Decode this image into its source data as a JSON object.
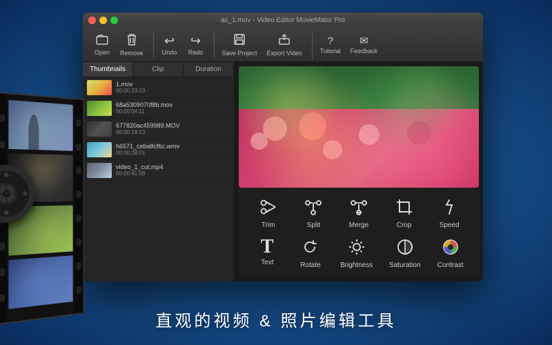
{
  "window": {
    "title": "ac_1.mov - Video Editor MovieMator Pro",
    "controls": {
      "close": "close",
      "minimize": "minimize",
      "maximize": "maximize"
    }
  },
  "toolbar": {
    "buttons": [
      {
        "id": "open",
        "label": "Open",
        "icon": "folder-icon"
      },
      {
        "id": "remove",
        "label": "Remove",
        "icon": "trash-icon"
      },
      {
        "id": "undo",
        "label": "Undo",
        "icon": "undo-icon"
      },
      {
        "id": "redo",
        "label": "Redo",
        "icon": "redo-icon"
      },
      {
        "id": "save",
        "label": "Save Project",
        "icon": "save-icon"
      },
      {
        "id": "export",
        "label": "Export Video",
        "icon": "export-icon"
      },
      {
        "id": "tutorial",
        "label": "Tutorial",
        "icon": "tutorial-icon"
      },
      {
        "id": "feedback",
        "label": "Feedback",
        "icon": "feedback-icon"
      }
    ]
  },
  "panel": {
    "tabs": [
      {
        "id": "thumbnails",
        "label": "Thumbnails",
        "active": true
      },
      {
        "id": "clip",
        "label": "Clip"
      },
      {
        "id": "duration",
        "label": "Duration"
      }
    ]
  },
  "clips": [
    {
      "name": "1.mov",
      "duration": "00:00:23:23",
      "thumb": "flowers"
    },
    {
      "name": "68a5309070f8b.mov",
      "duration": "00:00:04:11",
      "thumb": "nature"
    },
    {
      "name": "677820ac459989.MOV",
      "duration": "00:00:18:13",
      "thumb": "dark"
    },
    {
      "name": "h6571_ceba8cf6c.wmv",
      "duration": "00:00:28:01",
      "thumb": "beach"
    },
    {
      "name": "video_1_cut.mp4",
      "duration": "00:00:41:08",
      "thumb": "city"
    }
  ],
  "tools": {
    "row1": [
      {
        "id": "trim",
        "label": "Trim",
        "icon": "scissors-icon"
      },
      {
        "id": "split",
        "label": "Split",
        "icon": "split-icon"
      },
      {
        "id": "merge",
        "label": "Merge",
        "icon": "merge-icon"
      },
      {
        "id": "crop",
        "label": "Crop",
        "icon": "crop-icon"
      },
      {
        "id": "speed",
        "label": "Speed",
        "icon": "speed-icon"
      }
    ],
    "row2": [
      {
        "id": "text",
        "label": "Text",
        "icon": "text-icon"
      },
      {
        "id": "rotate",
        "label": "Rotate",
        "icon": "rotate-icon"
      },
      {
        "id": "brightness",
        "label": "Brightness",
        "icon": "brightness-icon"
      },
      {
        "id": "saturation",
        "label": "Saturation",
        "icon": "saturation-icon"
      },
      {
        "id": "contrast",
        "label": "Contrast",
        "icon": "contrast-icon"
      }
    ]
  },
  "footer": {
    "text": "直观的视频 &  照片编辑工具"
  },
  "colors": {
    "accent": "#4a90d9",
    "background_dark": "#2a2a2a",
    "toolbar_bg": "#3d3d3d",
    "text_primary": "#ffffff",
    "text_secondary": "#aaaaaa"
  }
}
